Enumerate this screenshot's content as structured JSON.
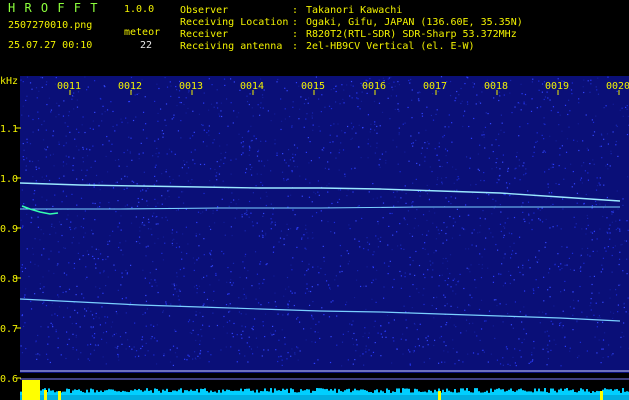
{
  "app": {
    "name": "H R O F F T",
    "version": "1.0.0"
  },
  "file": {
    "name": "2507270010.png",
    "datetime": "25.07.27 00:10"
  },
  "meteor": {
    "label": "meteor",
    "count": "22"
  },
  "info": [
    {
      "key": "Observer",
      "sep": ":",
      "value": "Takanori Kawachi"
    },
    {
      "key": "Receiving Location",
      "sep": ":",
      "value": "Ogaki, Gifu, JAPAN (136.60E, 35.35N)"
    },
    {
      "key": "Receiver",
      "sep": ":",
      "value": "R820T2(RTL-SDR) SDR-Sharp 53.372MHz"
    },
    {
      "key": "Receiving antenna",
      "sep": ":",
      "value": "2el-HB9CV Vertical (el. E-W)"
    }
  ],
  "axis": {
    "unit": "kHz",
    "y_ticks": [
      {
        "label": "1.1",
        "value": 1.1
      },
      {
        "label": "1.0",
        "value": 1.0
      },
      {
        "label": "0.9",
        "value": 0.9
      },
      {
        "label": "0.8",
        "value": 0.8
      },
      {
        "label": "0.7",
        "value": 0.7
      },
      {
        "label": "0.6",
        "value": 0.6
      }
    ],
    "x_ticks": [
      "0011",
      "0012",
      "0013",
      "0014",
      "0015",
      "0016",
      "0017",
      "0018",
      "0019",
      "0020"
    ]
  },
  "colors": {
    "background": "#0a0f78",
    "noise": "#2a3cff",
    "trace": "#9ae8ff",
    "header_green": "#8cff3c",
    "header_yellow": "#f2f200",
    "axis_text": "#f2f200",
    "bars": "#ffff00",
    "spectrum": "#00cfff"
  }
}
